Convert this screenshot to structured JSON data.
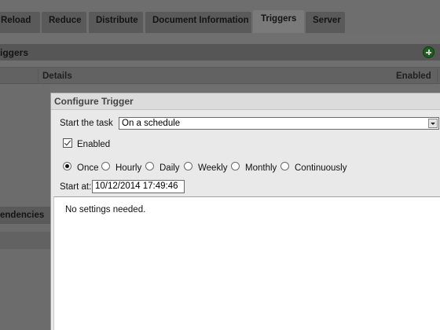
{
  "tabs": [
    {
      "label": "Reload"
    },
    {
      "label": "Reduce"
    },
    {
      "label": "Distribute"
    },
    {
      "label": "Document Information"
    },
    {
      "label": "Triggers",
      "active": true
    },
    {
      "label": "Server"
    }
  ],
  "section": {
    "title": "iggers"
  },
  "table": {
    "columns": [
      "Details",
      "Enabled"
    ]
  },
  "left_panel": {
    "dependencies_label": "endencies"
  },
  "dialog": {
    "title": "Configure Trigger",
    "start_task_label": "Start the task",
    "start_task_value": "On a schedule",
    "enabled_label": "Enabled",
    "enabled_checked": true,
    "frequency_options": [
      "Once",
      "Hourly",
      "Daily",
      "Weekly",
      "Monthly",
      "Continuously"
    ],
    "frequency_selected": "Once",
    "start_at_label": "Start at:",
    "start_at_value": "10/12/2014 17:49:46",
    "settings_text": "No settings needed."
  },
  "colors": {
    "accent_add": "#1f5e1f",
    "overlay": "#6f6f6f",
    "dialog_bg": "#e9e9e9"
  },
  "icons": [
    "add-icon",
    "dropdown-arrow-icon",
    "checkbox-check-icon"
  ]
}
